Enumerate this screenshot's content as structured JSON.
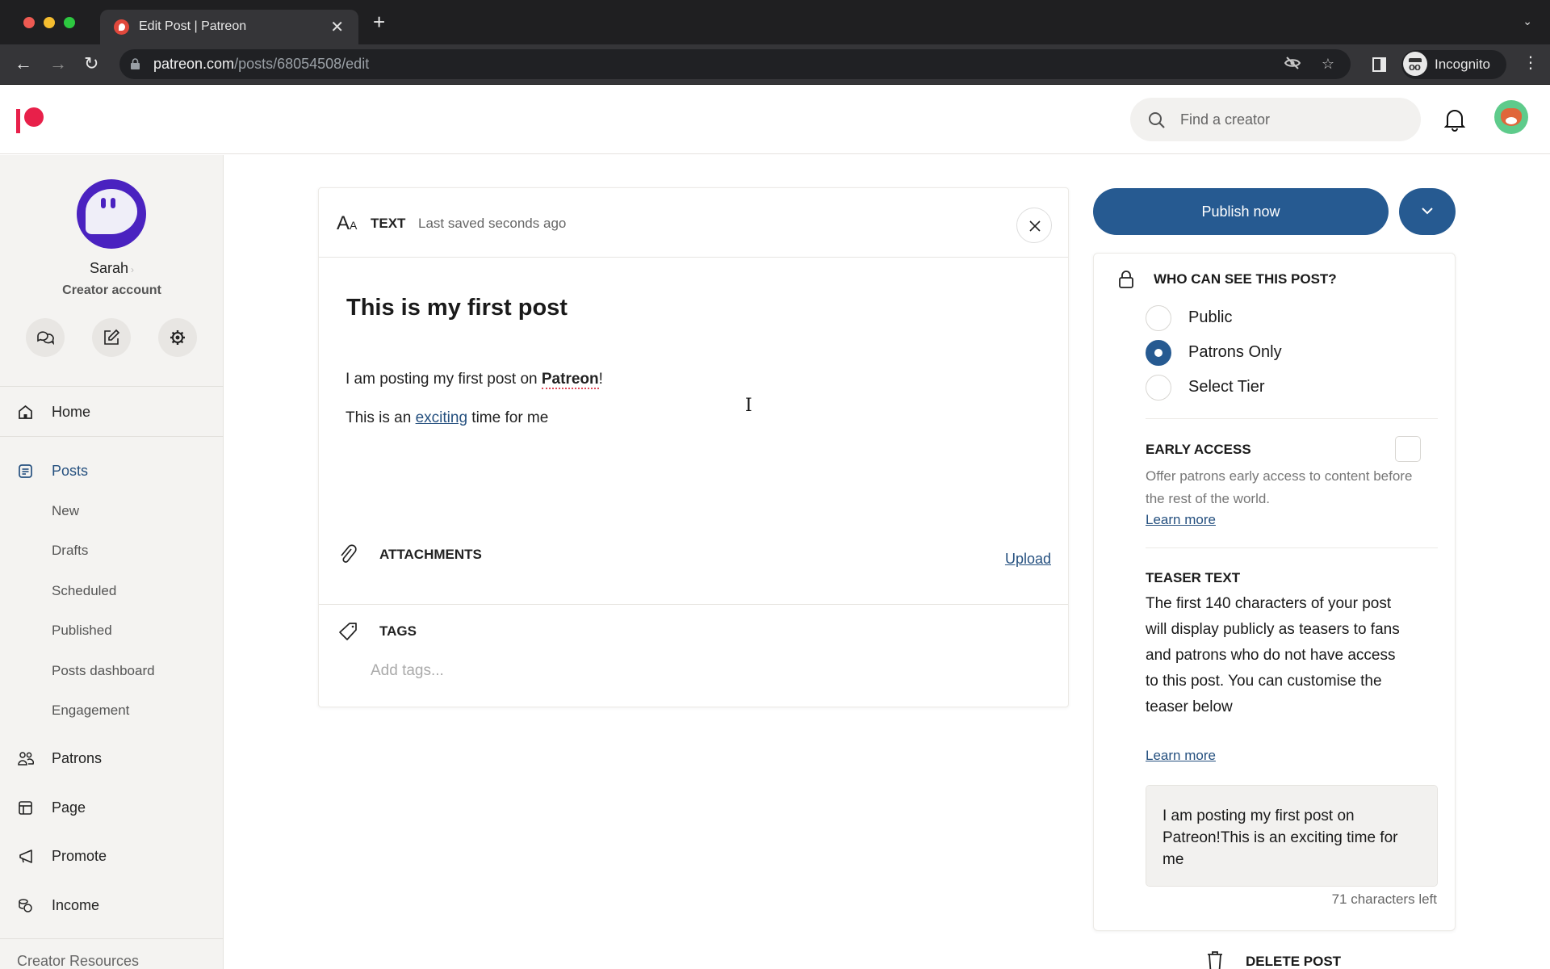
{
  "browser": {
    "tab_title": "Edit Post | Patreon",
    "url_domain": "patreon.com",
    "url_path": "/posts/68054508/edit",
    "profile_label": "Incognito"
  },
  "header": {
    "search_placeholder": "Find a creator"
  },
  "sidebar": {
    "creator_name": "Sarah",
    "creator_type": "Creator account",
    "nav": [
      {
        "label": "Home",
        "icon": "home-icon"
      },
      {
        "label": "Posts",
        "icon": "posts-icon",
        "active": true
      },
      {
        "label": "Patrons",
        "icon": "patrons-icon"
      },
      {
        "label": "Page",
        "icon": "page-icon"
      },
      {
        "label": "Promote",
        "icon": "megaphone-icon"
      },
      {
        "label": "Income",
        "icon": "coins-icon"
      }
    ],
    "posts_sub": [
      "New",
      "Drafts",
      "Scheduled",
      "Published",
      "Posts dashboard",
      "Engagement"
    ],
    "resources_label": "Creator Resources"
  },
  "editor": {
    "type_label": "TEXT",
    "saved_status": "Last saved seconds ago",
    "post_title": "This is my first post",
    "p1_before": "I am posting my first post on ",
    "p1_bold": "Patreon",
    "p1_after": "!",
    "p2_before": "This is an ",
    "p2_link": "exciting",
    "p2_after": " time for me",
    "attachments_label": "ATTACHMENTS",
    "upload_label": "Upload",
    "tags_label": "TAGS",
    "tags_placeholder": "Add tags..."
  },
  "publish": {
    "button_label": "Publish now"
  },
  "settings": {
    "who_label": "WHO CAN SEE THIS POST?",
    "visibility_options": [
      "Public",
      "Patrons Only",
      "Select Tier"
    ],
    "selected_visibility": "Patrons Only",
    "early_access_label": "EARLY ACCESS",
    "early_access_checked": false,
    "early_access_desc": "Offer patrons early access to content before the rest of the world.",
    "learn_more": "Learn more",
    "teaser_label": "TEASER TEXT",
    "teaser_desc": "The first 140 characters of your post will display publicly as teasers to fans and patrons who do not have access to this post. You can customise the teaser below",
    "teaser_value": "I am posting my first post on Patreon!This is an exciting time for me",
    "chars_left": "71 characters left",
    "delete_label": "DELETE POST"
  },
  "colors": {
    "brand": "#e8204a",
    "accent": "#265a91",
    "link": "#25507f"
  }
}
